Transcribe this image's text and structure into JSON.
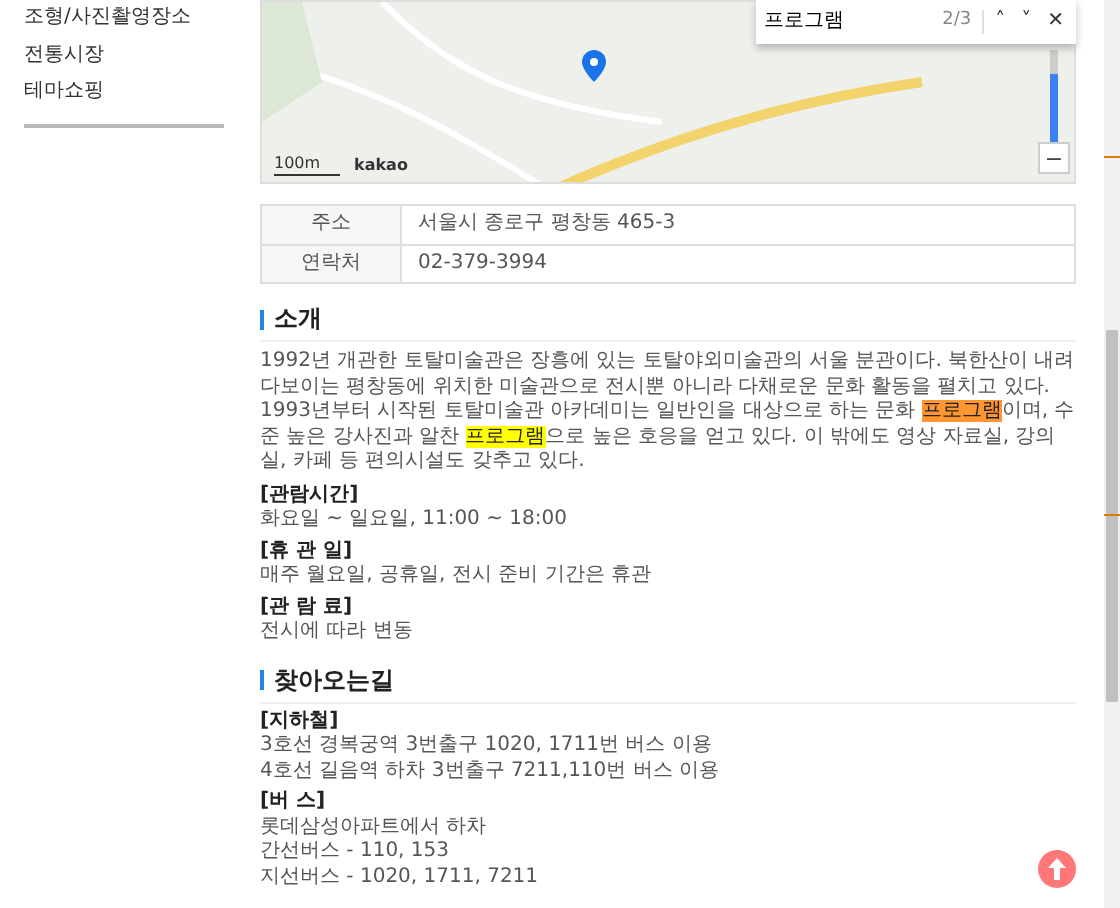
{
  "sidebar": {
    "items": [
      "조형/사진촬영장소",
      "전통시장",
      "테마쇼핑"
    ]
  },
  "map": {
    "zoom_slider": {
      "level": 0.75
    },
    "zoom_out": "−",
    "scale": "100m",
    "logo": "kakao"
  },
  "find_bar": {
    "value": "프로그램",
    "count": "2/3",
    "prev": "˄",
    "next": "˅",
    "close": "✕"
  },
  "info_table": [
    {
      "label": "주소",
      "value": "서울시 종로구 평창동 465-3"
    },
    {
      "label": "연락처",
      "value": "02-379-3994"
    }
  ],
  "intro": {
    "title": "소개",
    "paragraph": [
      {
        "text": "1992년 개관한 토탈미술관은 장흥에 있는 토탈야외미술관의 서울 분관이다. 북한산이 내려다보이는 평창동에 위치한 미술관으로 전시뿐 아니라 다채로운 문화 활동을 펼치고 있다. 1993년부터 시작된 토탈미술관 아카데미는 일반인을 대상으로 하는 문화 ",
        "highlighted": false
      },
      {
        "text": "프로그램",
        "highlighted": true,
        "current": true
      },
      {
        "text": "이며, 수준 높은 강사진과 알찬 ",
        "highlighted": false
      },
      {
        "text": "프로그램",
        "highlighted": true,
        "current": false
      },
      {
        "text": "으로 높은 호응을 얻고 있다. 이 밖에도 영상 자료실, 강의실, 카페 등 편의시설도 갖추고 있다.",
        "highlighted": false
      }
    ],
    "details": [
      {
        "heading": "[관람시간]",
        "lines": [
          "화요일 ~ 일요일, 11:00 ~ 18:00"
        ]
      },
      {
        "heading": "[휴 관 일]",
        "lines": [
          "매주 월요일, 공휴일, 전시 준비 기간은 휴관"
        ]
      },
      {
        "heading": "[관 람 료]",
        "lines": [
          "전시에 따라 변동"
        ]
      }
    ]
  },
  "directions": {
    "title": "찾아오는길",
    "details": [
      {
        "heading": "[지하철]",
        "lines": [
          "3호선 경복궁역 3번출구 1020, 1711번 버스 이용",
          "4호선 길음역 하차 3번출구 7211,110번 버스 이용"
        ]
      },
      {
        "heading": "[버 스]",
        "lines": [
          "롯데삼성아파트에서 하차",
          "간선버스 - 110, 153",
          "지선버스 - 1020, 1711, 7211"
        ]
      }
    ]
  }
}
